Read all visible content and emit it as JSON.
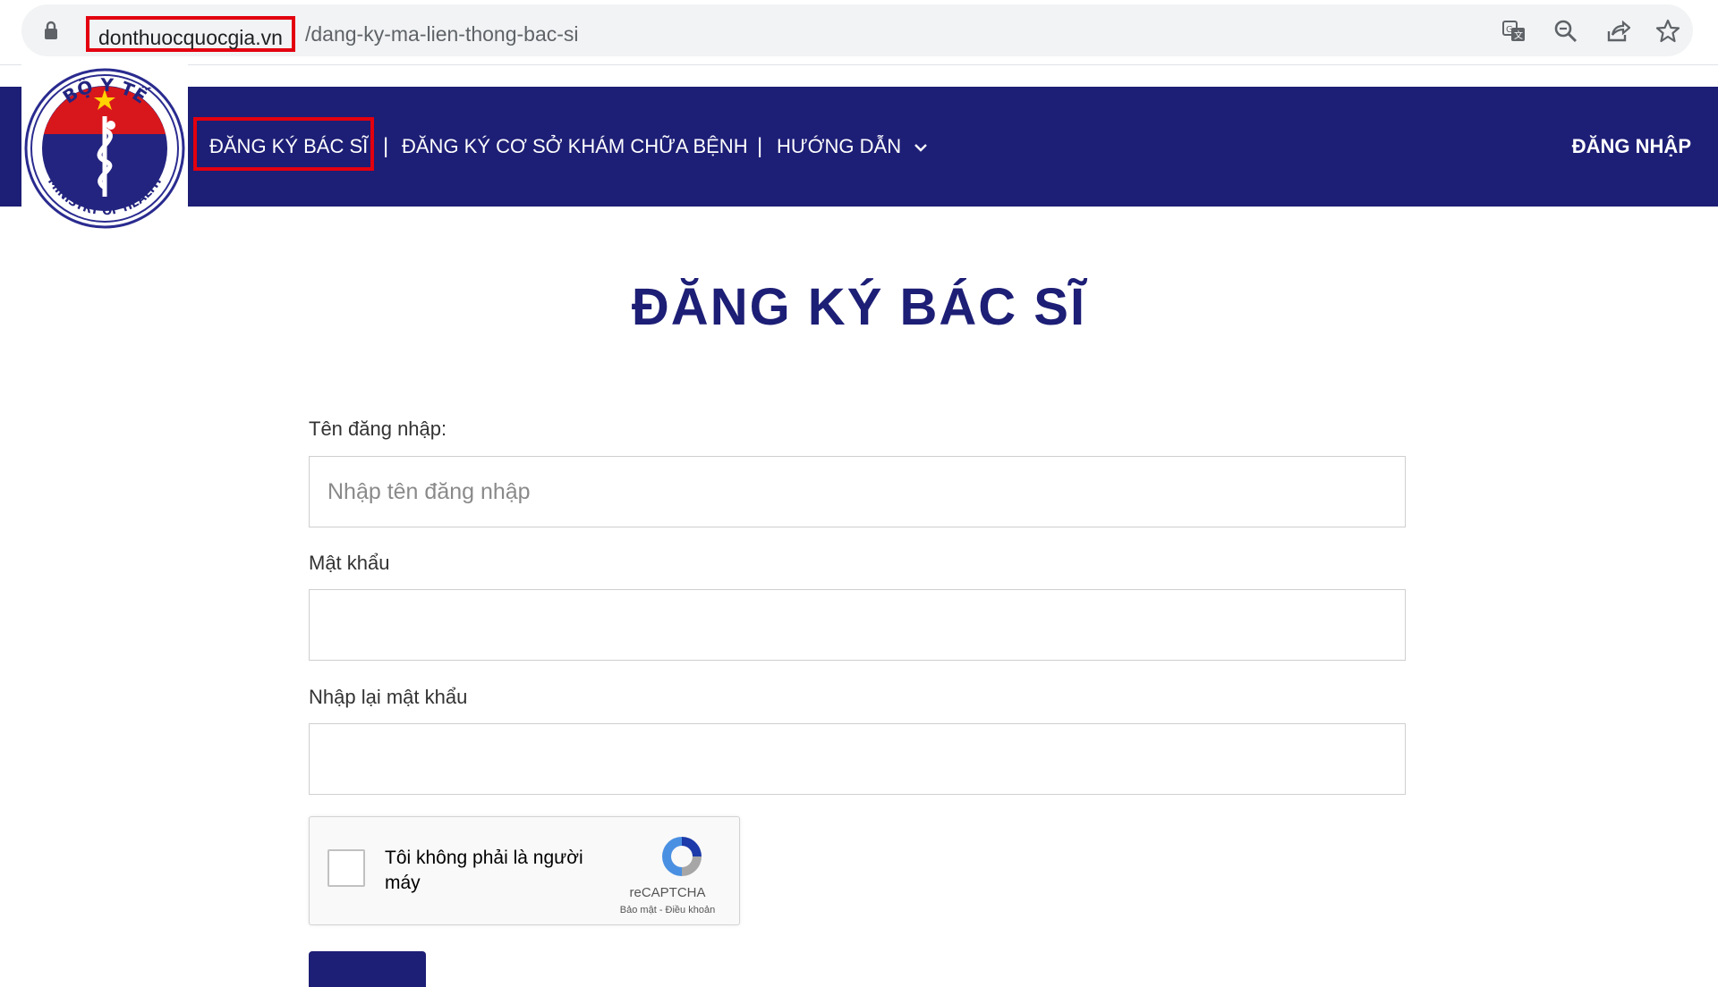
{
  "browser": {
    "url_domain": "donthuocquocgia.vn",
    "url_path": "/dang-ky-ma-lien-thong-bac-si",
    "icons": [
      "lock-icon",
      "translate-icon",
      "zoom-icon",
      "share-icon",
      "bookmark-star-icon"
    ]
  },
  "header": {
    "logo": {
      "text_top": "BỘ Y TẾ",
      "text_bottom": "MINISTRY OF HEALTH"
    },
    "nav": [
      {
        "label": "ĐĂNG KÝ BÁC SĨ"
      },
      {
        "label": "ĐĂNG KÝ CƠ SỞ KHÁM CHỮA BỆNH"
      },
      {
        "label": "HƯỚNG DẪN"
      }
    ],
    "separator": "|",
    "login_label": "ĐĂNG NHẬP"
  },
  "main": {
    "title": "ĐĂNG KÝ BÁC SĨ",
    "fields": [
      {
        "label": "Tên đăng nhập:",
        "placeholder": "Nhập tên đăng nhập",
        "value": ""
      },
      {
        "label": "Mật khẩu",
        "placeholder": "",
        "value": ""
      },
      {
        "label": "Nhập lại mật khẩu",
        "placeholder": "",
        "value": ""
      }
    ],
    "captcha": {
      "label": "Tôi không phải là người máy",
      "brand": "reCAPTCHA",
      "terms": "Bảo mật - Điều khoản"
    }
  },
  "colors": {
    "header_bg": "#1d1e75",
    "highlight_border": "#e3000f",
    "title": "#1d1e75"
  }
}
